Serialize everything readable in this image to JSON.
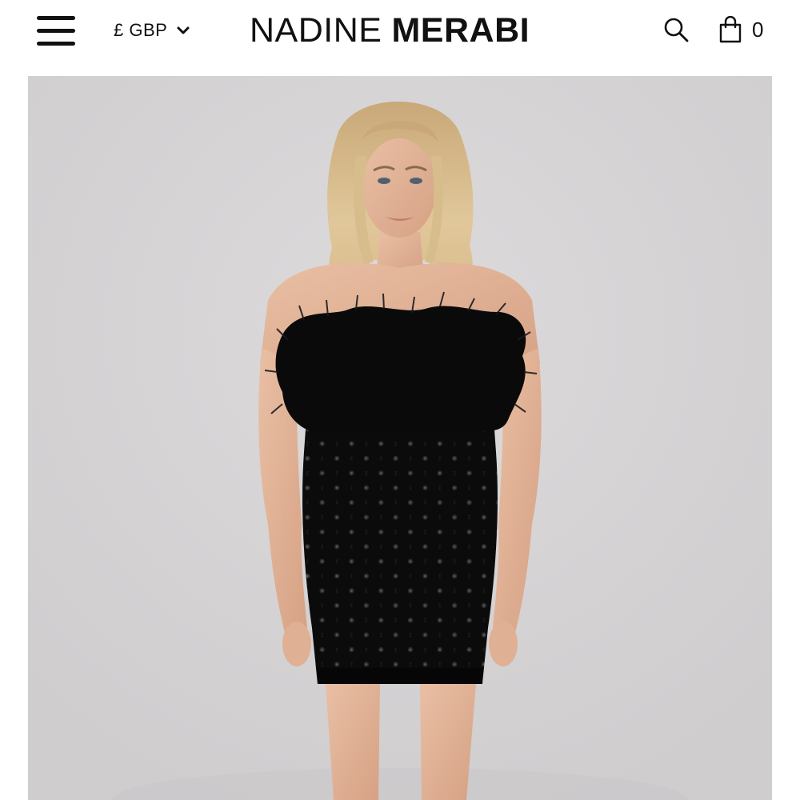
{
  "header": {
    "currency": {
      "label": "£ GBP"
    },
    "logo": {
      "light": "NADINE",
      "bold": "MERABI"
    },
    "cart": {
      "count": "0"
    }
  },
  "icons": {
    "menu": "hamburger-menu-icon",
    "currency_dropdown": "chevron-down-icon",
    "search": "search-icon",
    "cart": "shopping-bag-icon"
  },
  "product_image": {
    "alt_subject": "model in strapless black feather-trim sequin mini dress"
  }
}
